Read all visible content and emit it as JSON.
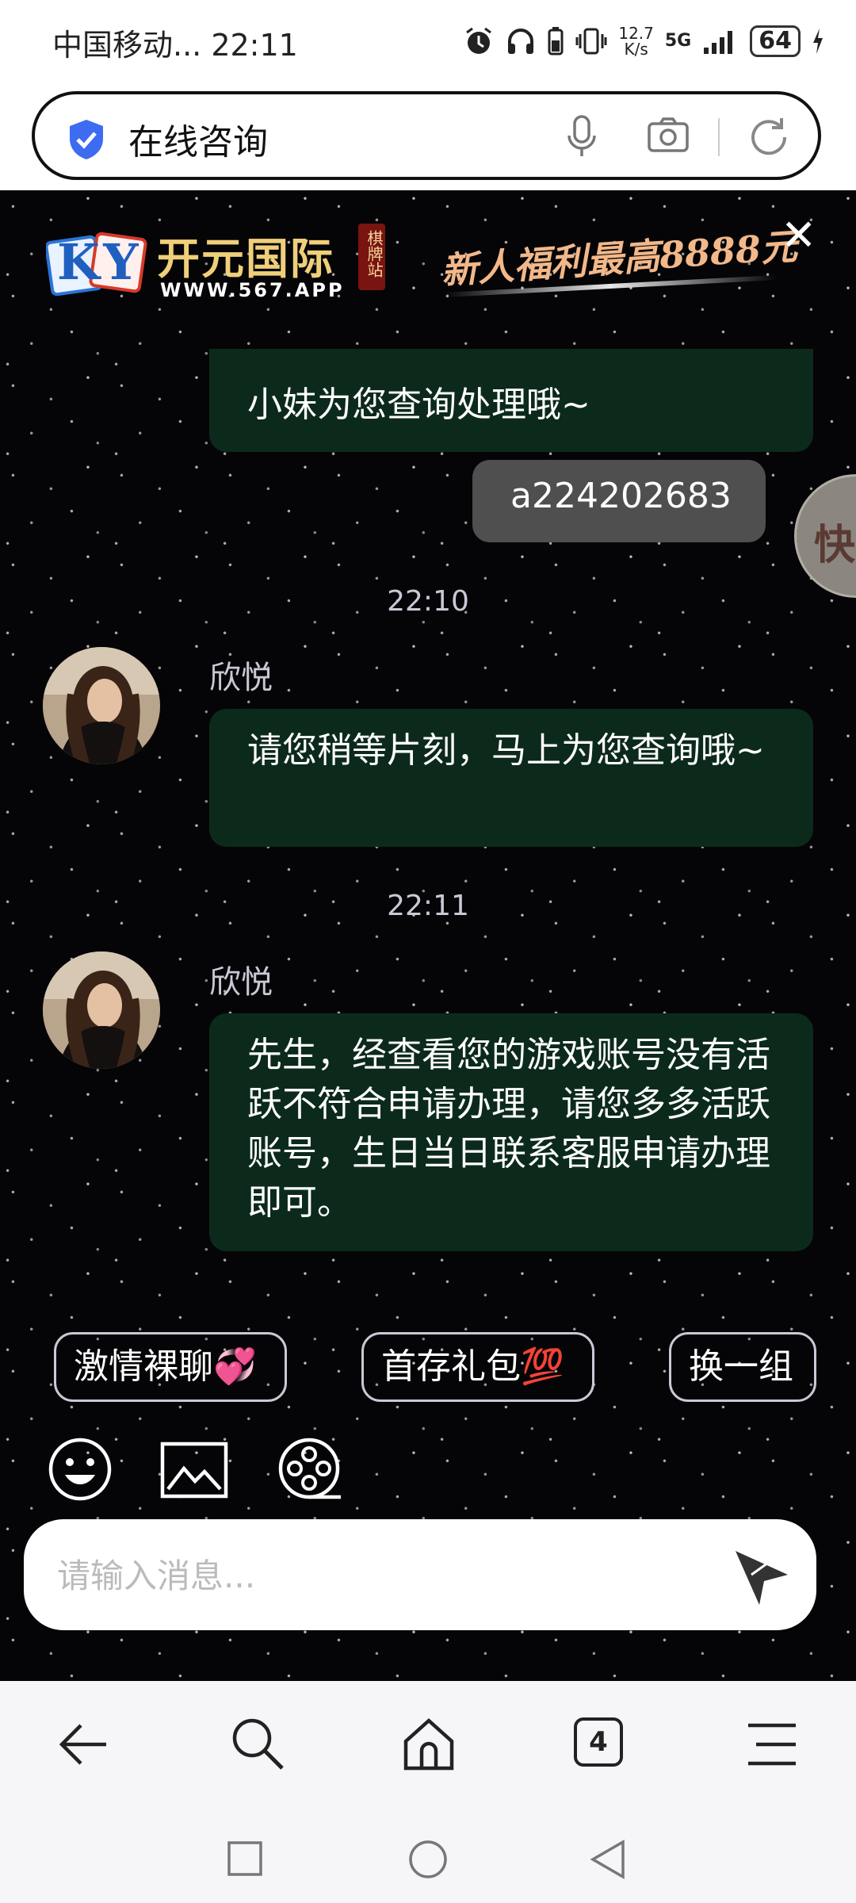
{
  "status_bar": {
    "carrier_time": "中国移动...  22:11",
    "network_speed_top": "12.7",
    "network_speed_bottom": "K/s",
    "signal_label": "5G",
    "battery": "64"
  },
  "browser": {
    "page_title": "在线咨询"
  },
  "banner": {
    "logo_text": "KY",
    "brand_name": "开元国际",
    "brand_tag": "棋牌站",
    "url": "WWW.567.APP",
    "promo": "新人福利最高8888元"
  },
  "float_button": {
    "label": "快"
  },
  "messages": {
    "m1": "小妹为您查询处理哦~",
    "m2": "a224202683",
    "t1": "22:10",
    "n1": "欣悦",
    "m3": "请您稍等片刻，马上为您查询哦~",
    "t2": "22:11",
    "n2": "欣悦",
    "m4": "先生，经查看您的游戏账号没有活跃不符合申请办理，请您多多活跃账号，生日当日联系客服申请办理即可。"
  },
  "quick_replies": {
    "q1": "激情裸聊💞",
    "q2": "首存礼包💯",
    "q3": "换一组"
  },
  "input": {
    "placeholder": "请输入消息..."
  },
  "bottom_nav": {
    "tabs_count": "4"
  },
  "colors": {
    "chat_bg": "#050507",
    "agent_bubble": "#0c2a1c",
    "user_bubble": "#4f4f4f",
    "shield": "#3d6cf0"
  }
}
